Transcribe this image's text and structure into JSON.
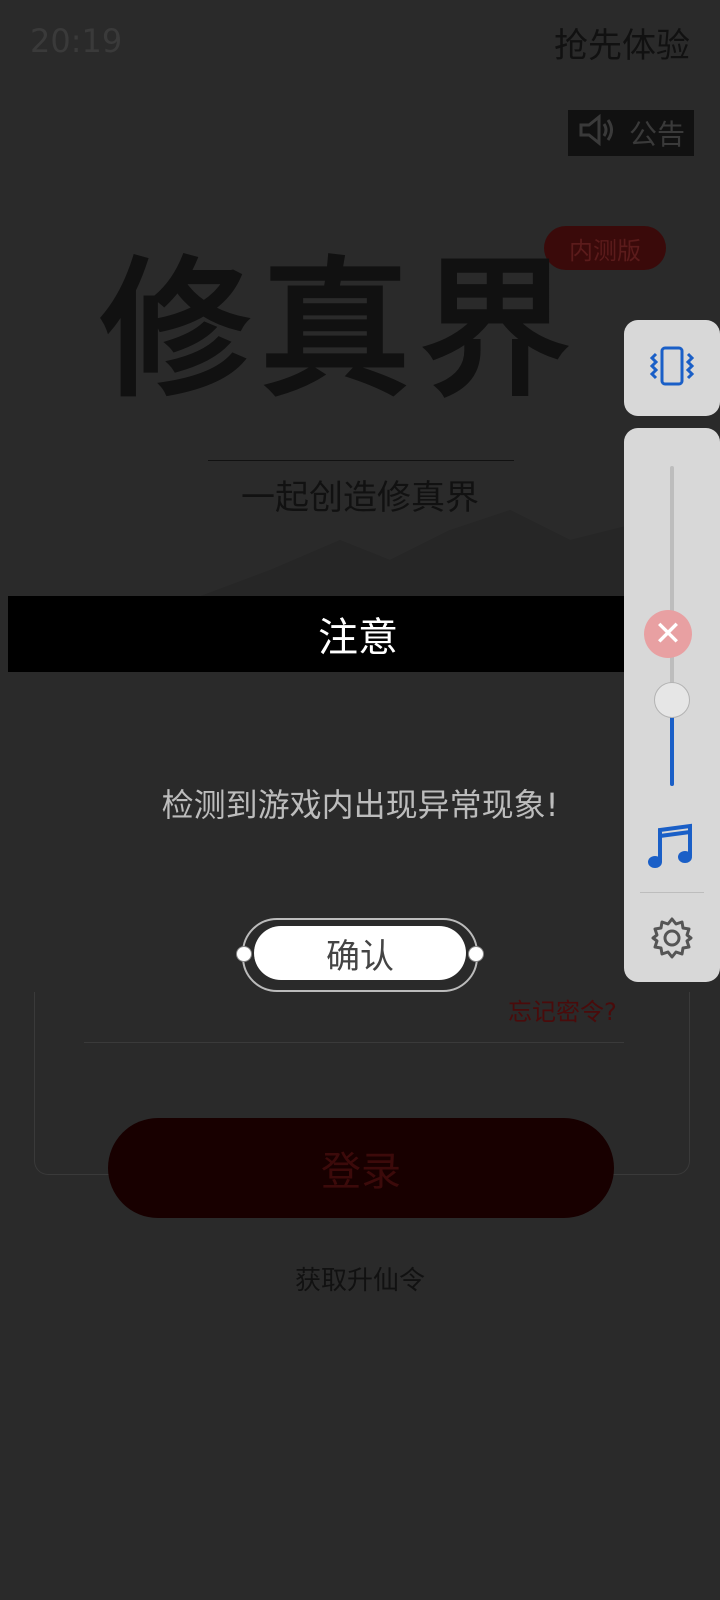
{
  "status": {
    "time": "20:19"
  },
  "topbar": {
    "right_action": "抢先体验",
    "announcement": "公告"
  },
  "brand": {
    "beta_badge": "内测版",
    "logo_text": "修真界",
    "tagline": "一起创造修真界"
  },
  "login": {
    "forgot_password": "忘记密令?",
    "login_button": "登录",
    "get_token": "获取升仙令"
  },
  "dialog": {
    "title": "注意",
    "message": "检测到游戏内出现异常现象!",
    "confirm": "确认"
  },
  "volume_panel": {
    "vibrate_icon": "vibrate-icon",
    "close_icon": "close-icon",
    "music_icon": "music-note-icon",
    "settings_icon": "gear-icon",
    "accent_color": "#1a5fc7",
    "level_fraction": 0.27
  }
}
